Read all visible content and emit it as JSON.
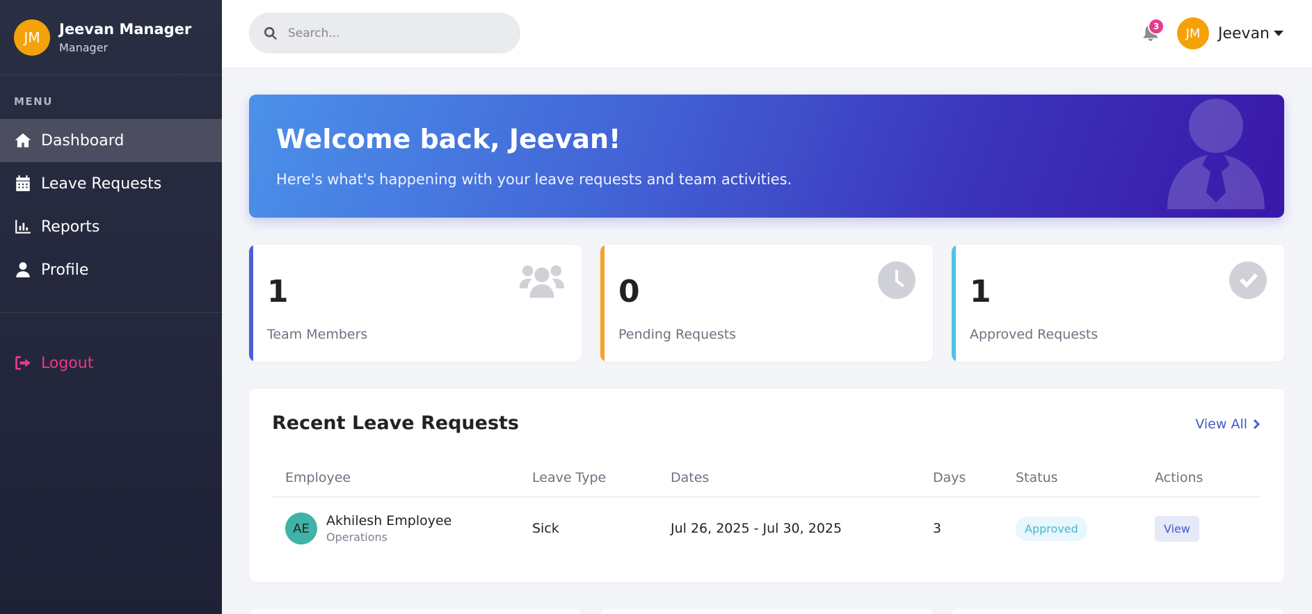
{
  "sidebar": {
    "user": {
      "initials": "JM",
      "name": "Jeevan Manager",
      "role": "Manager"
    },
    "menu_title": "MENU",
    "items": [
      {
        "label": "Dashboard",
        "icon": "home-icon",
        "active": true
      },
      {
        "label": "Leave Requests",
        "icon": "calendar-icon",
        "active": false
      },
      {
        "label": "Reports",
        "icon": "chart-bar-icon",
        "active": false
      },
      {
        "label": "Profile",
        "icon": "user-icon",
        "active": false
      }
    ],
    "logout_label": "Logout"
  },
  "topbar": {
    "search_placeholder": "Search...",
    "notification_count": "3",
    "user_initials": "JM",
    "user_name": "Jeevan"
  },
  "banner": {
    "title": "Welcome back, Jeevan!",
    "subtitle": "Here's what's happening with your leave requests and team activities."
  },
  "stats": [
    {
      "value": "1",
      "label": "Team Members",
      "accent": "#4e5fd6",
      "icon": "users-icon"
    },
    {
      "value": "0",
      "label": "Pending Requests",
      "accent": "#f5a22a",
      "icon": "clock-icon"
    },
    {
      "value": "1",
      "label": "Approved Requests",
      "accent": "#4ec3e6",
      "icon": "check-circle-icon"
    }
  ],
  "recent": {
    "title": "Recent Leave Requests",
    "view_all": "View All",
    "columns": [
      "Employee",
      "Leave Type",
      "Dates",
      "Days",
      "Status",
      "Actions"
    ],
    "rows": [
      {
        "initials": "AE",
        "employee": "Akhilesh Employee",
        "department": "Operations",
        "leave_type": "Sick",
        "dates": "Jul 26, 2025 - Jul 30, 2025",
        "days": "3",
        "status": "Approved",
        "action": "View"
      }
    ]
  },
  "colors": {
    "sidebar_bg": "#252839",
    "accent_pink": "#e83a8c",
    "avatar_orange": "#f5a20a",
    "link_blue": "#3f5cc8"
  }
}
